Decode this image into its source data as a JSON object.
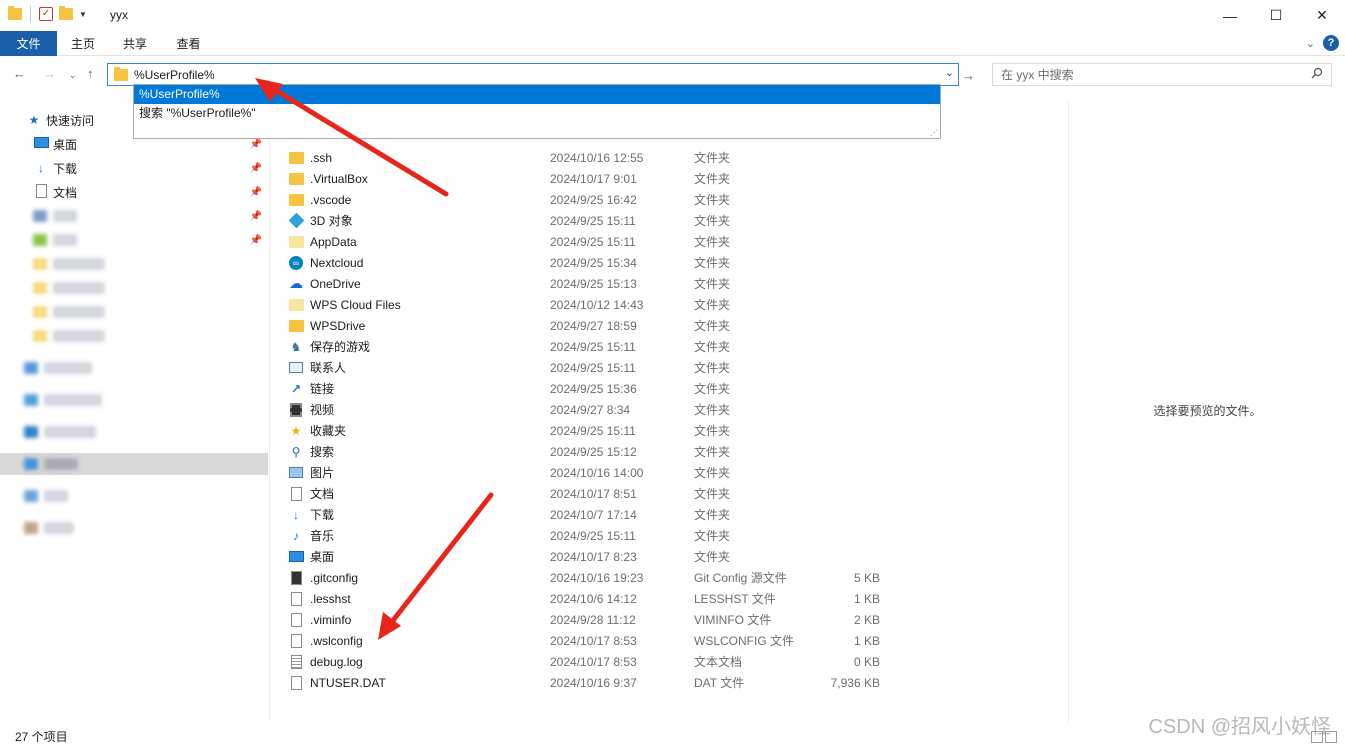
{
  "window": {
    "title": "yyx",
    "minimize": "—",
    "maximize": "☐",
    "close": "✕"
  },
  "ribbon": {
    "tabs": [
      "文件",
      "主页",
      "共享",
      "查看"
    ],
    "help": "?"
  },
  "address": {
    "value": "%UserProfile%"
  },
  "search": {
    "placeholder": "在 yyx 中搜索"
  },
  "autocomplete": {
    "items": [
      "%UserProfile%",
      "搜索 \"%UserProfile%\""
    ]
  },
  "sidebar": {
    "quick_access": "快速访问",
    "pinned": [
      {
        "label": "桌面",
        "icon": "desktop-icon"
      },
      {
        "label": "下载",
        "icon": "download-icon"
      },
      {
        "label": "文档",
        "icon": "document-icon"
      }
    ]
  },
  "files": [
    {
      "name": ".ssh",
      "date": "2024/10/16 12:55",
      "type": "文件夹",
      "size": "",
      "icon": "folder"
    },
    {
      "name": ".VirtualBox",
      "date": "2024/10/17 9:01",
      "type": "文件夹",
      "size": "",
      "icon": "folder"
    },
    {
      "name": ".vscode",
      "date": "2024/9/25 16:42",
      "type": "文件夹",
      "size": "",
      "icon": "folder"
    },
    {
      "name": "3D 对象",
      "date": "2024/9/25 15:11",
      "type": "文件夹",
      "size": "",
      "icon": "3d"
    },
    {
      "name": "AppData",
      "date": "2024/9/25 15:11",
      "type": "文件夹",
      "size": "",
      "icon": "folder-pale"
    },
    {
      "name": "Nextcloud",
      "date": "2024/9/25 15:34",
      "type": "文件夹",
      "size": "",
      "icon": "nextcloud"
    },
    {
      "name": "OneDrive",
      "date": "2024/9/25 15:13",
      "type": "文件夹",
      "size": "",
      "icon": "onedrive"
    },
    {
      "name": "WPS Cloud Files",
      "date": "2024/10/12 14:43",
      "type": "文件夹",
      "size": "",
      "icon": "folder-pale"
    },
    {
      "name": "WPSDrive",
      "date": "2024/9/27 18:59",
      "type": "文件夹",
      "size": "",
      "icon": "folder"
    },
    {
      "name": "保存的游戏",
      "date": "2024/9/25 15:11",
      "type": "文件夹",
      "size": "",
      "icon": "games"
    },
    {
      "name": "联系人",
      "date": "2024/9/25 15:11",
      "type": "文件夹",
      "size": "",
      "icon": "contacts"
    },
    {
      "name": "链接",
      "date": "2024/9/25 15:36",
      "type": "文件夹",
      "size": "",
      "icon": "links"
    },
    {
      "name": "视频",
      "date": "2024/9/27 8:34",
      "type": "文件夹",
      "size": "",
      "icon": "video"
    },
    {
      "name": "收藏夹",
      "date": "2024/9/25 15:11",
      "type": "文件夹",
      "size": "",
      "icon": "star"
    },
    {
      "name": "搜索",
      "date": "2024/9/25 15:12",
      "type": "文件夹",
      "size": "",
      "icon": "search"
    },
    {
      "name": "图片",
      "date": "2024/10/16 14:00",
      "type": "文件夹",
      "size": "",
      "icon": "pictures"
    },
    {
      "name": "文档",
      "date": "2024/10/17 8:51",
      "type": "文件夹",
      "size": "",
      "icon": "documents"
    },
    {
      "name": "下载",
      "date": "2024/10/7 17:14",
      "type": "文件夹",
      "size": "",
      "icon": "downloads"
    },
    {
      "name": "音乐",
      "date": "2024/9/25 15:11",
      "type": "文件夹",
      "size": "",
      "icon": "music"
    },
    {
      "name": "桌面",
      "date": "2024/10/17 8:23",
      "type": "文件夹",
      "size": "",
      "icon": "desktop"
    },
    {
      "name": ".gitconfig",
      "date": "2024/10/16 19:23",
      "type": "Git Config 源文件",
      "size": "5 KB",
      "icon": "gitconfig"
    },
    {
      "name": ".lesshst",
      "date": "2024/10/6 14:12",
      "type": "LESSHST 文件",
      "size": "1 KB",
      "icon": "file"
    },
    {
      "name": ".viminfo",
      "date": "2024/9/28 11:12",
      "type": "VIMINFO 文件",
      "size": "2 KB",
      "icon": "file"
    },
    {
      "name": ".wslconfig",
      "date": "2024/10/17 8:53",
      "type": "WSLCONFIG 文件",
      "size": "1 KB",
      "icon": "file"
    },
    {
      "name": "debug.log",
      "date": "2024/10/17 8:53",
      "type": "文本文档",
      "size": "0 KB",
      "icon": "text"
    },
    {
      "name": "NTUSER.DAT",
      "date": "2024/10/16 9:37",
      "type": "DAT 文件",
      "size": "7,936 KB",
      "icon": "file"
    }
  ],
  "preview": {
    "message": "选择要预览的文件。"
  },
  "status": {
    "count": "27 个项目"
  },
  "watermark": "CSDN @招风小妖怪"
}
